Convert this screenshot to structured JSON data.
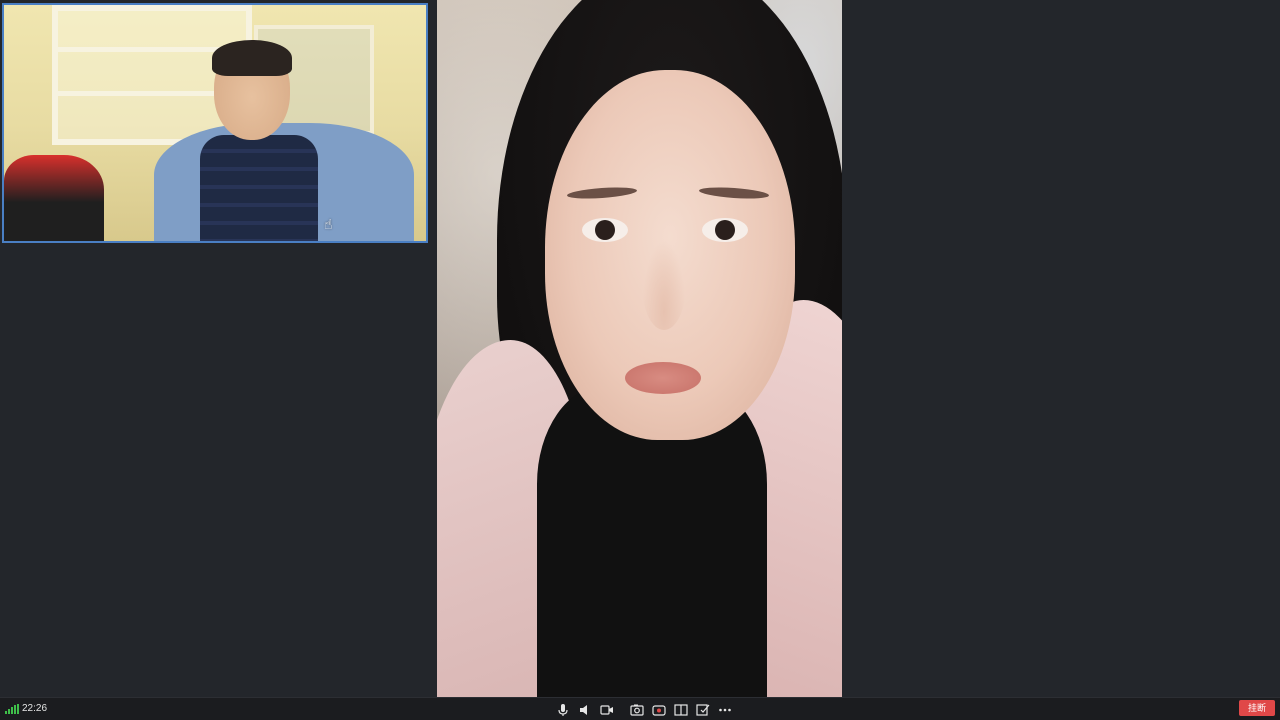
{
  "status_bar": {
    "time": "22:26"
  },
  "controls": {
    "icons": [
      "microphone-icon",
      "speaker-icon",
      "video-camera-icon",
      "screenshot-icon",
      "record-icon",
      "layout-icon",
      "whiteboard-icon",
      "more-icon"
    ]
  },
  "hangup": {
    "label": "挂断",
    "color": "#e04848"
  },
  "colors": {
    "background": "#23262b",
    "toolbar": "#1b1c1f",
    "self_view_border": "#4a7fc4",
    "signal": "#3fbf4a"
  }
}
